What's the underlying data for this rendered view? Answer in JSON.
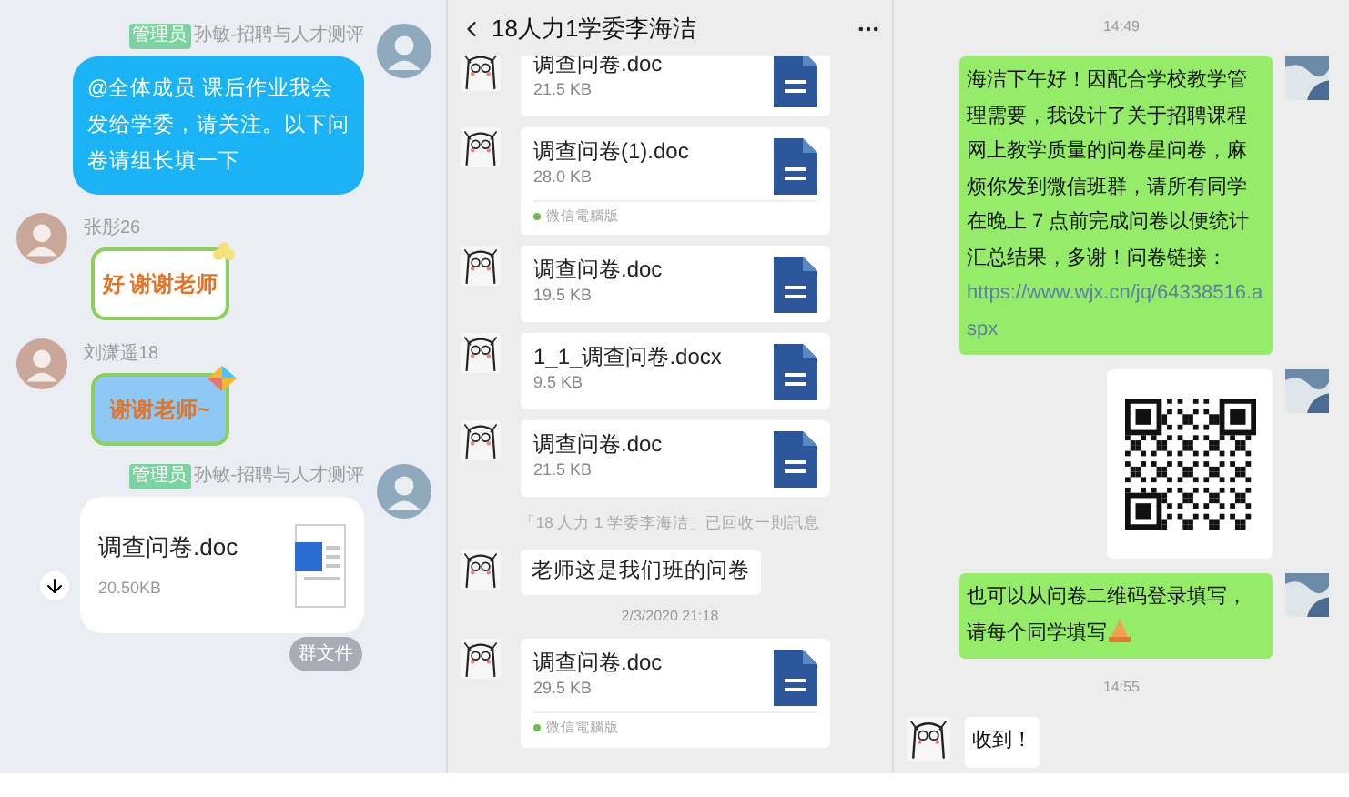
{
  "left_chat": {
    "messages": [
      {
        "kind": "text",
        "outgoing": true,
        "role": "管理员",
        "sender": "孙敏-招聘与人才测评",
        "text": "@全体成员 课后作业我会发给学委，请关注。以下问卷请组长填一下"
      },
      {
        "kind": "sticker",
        "outgoing": false,
        "sender": "张彤26",
        "text": "好 谢谢老师",
        "color": "#ffffff"
      },
      {
        "kind": "sticker",
        "outgoing": false,
        "sender": "刘潇遥18",
        "text": "谢谢老师~",
        "color": "#8ec9f5"
      },
      {
        "kind": "file",
        "outgoing": true,
        "role": "管理员",
        "sender": "孙敏-招聘与人才测评",
        "file_name": "调查问卷.doc",
        "size": "20.50KB"
      }
    ],
    "group_files_button": "群文件"
  },
  "middle_chat": {
    "title": "18人力1学委李海洁",
    "messages": [
      {
        "kind": "file",
        "file_name": "调查问卷.doc",
        "size": "21.5 KB",
        "cut_top": true
      },
      {
        "kind": "file",
        "file_name": "调查问卷(1).doc",
        "size": "28.0 KB",
        "source": "微信電腦版"
      },
      {
        "kind": "file",
        "file_name": "调查问卷.doc",
        "size": "19.5 KB"
      },
      {
        "kind": "file",
        "file_name": "1_1_调查问卷.docx",
        "size": "9.5 KB"
      },
      {
        "kind": "file",
        "file_name": "调查问卷.doc",
        "size": "21.5 KB"
      },
      {
        "kind": "notice",
        "text": "「18 人力 1 学委李海洁」已回收一則訊息"
      },
      {
        "kind": "text",
        "text": "老师这是我们班的问卷"
      },
      {
        "kind": "time",
        "text": "2/3/2020 21:18"
      },
      {
        "kind": "file",
        "file_name": "调查问卷.doc",
        "size": "29.5 KB",
        "source": "微信電腦版"
      }
    ]
  },
  "right_chat": {
    "messages": [
      {
        "kind": "time",
        "text": "14:49"
      },
      {
        "kind": "text",
        "outgoing": true,
        "text": "海洁下午好！因配合学校教学管理需要，我设计了关于招聘课程网上教学质量的问卷星问卷，麻烦你发到微信班群，请所有同学在晚上 7 点前完成问卷以便统计汇总结果，多谢！问卷链接：",
        "link": "https://www.wjx.cn/jq/64338516.aspx"
      },
      {
        "kind": "qr",
        "outgoing": true
      },
      {
        "kind": "text",
        "outgoing": true,
        "text": "也可以从问卷二维码登录填写，请每个同学填写",
        "emoji": true
      },
      {
        "kind": "time",
        "text": "14:55"
      },
      {
        "kind": "text",
        "outgoing": false,
        "text": "收到！"
      }
    ]
  }
}
